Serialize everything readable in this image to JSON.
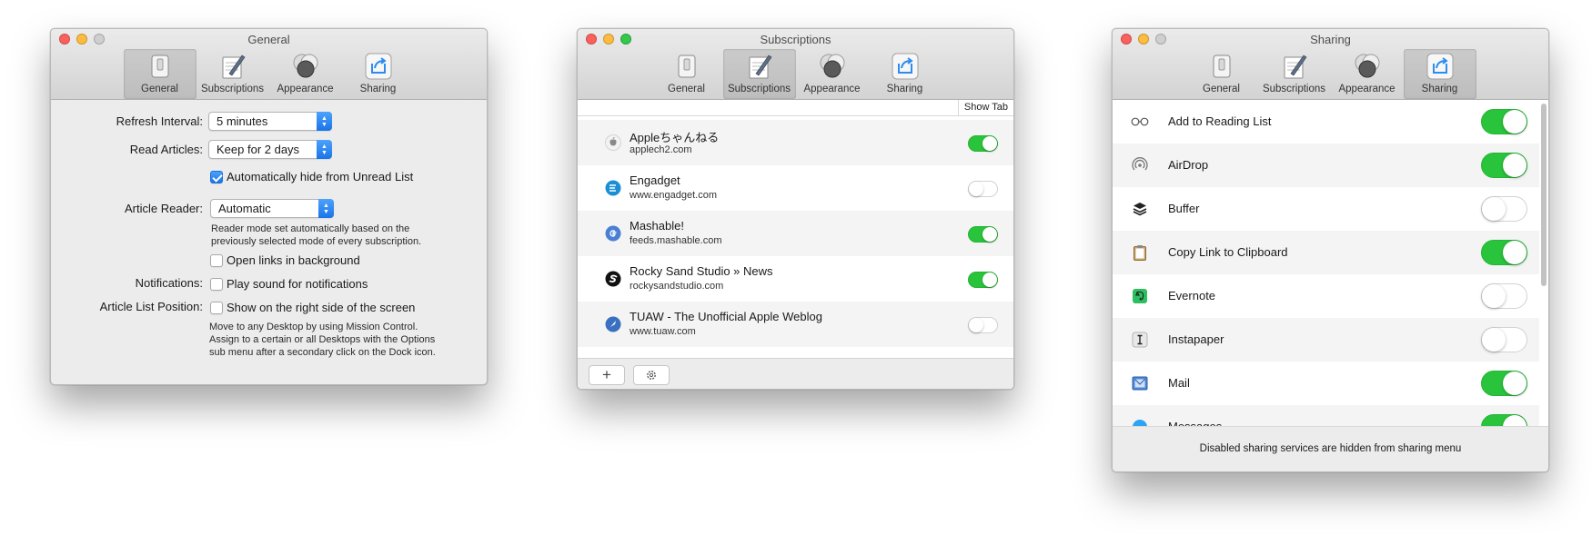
{
  "general_window": {
    "title": "General",
    "tabs": [
      "General",
      "Subscriptions",
      "Appearance",
      "Sharing"
    ],
    "active_tab": "General",
    "refresh_interval": {
      "label": "Refresh Interval:",
      "value": "5 minutes"
    },
    "read_articles": {
      "label": "Read Articles:",
      "value": "Keep for 2 days"
    },
    "auto_hide": {
      "label": "Automatically hide from Unread List",
      "checked": true
    },
    "article_reader": {
      "label": "Article Reader:",
      "value": "Automatic",
      "note_line1": "Reader mode set automatically based on the",
      "note_line2": "previously selected mode of every subscription."
    },
    "open_links": {
      "label": "Open links in background",
      "checked": false
    },
    "notifications": {
      "label": "Notifications:",
      "option": "Play sound for notifications",
      "checked": false
    },
    "article_list_position": {
      "label": "Article List Position:",
      "option": "Show on the right side of the screen",
      "checked": false,
      "note_line1": "Move to any Desktop by using Mission Control.",
      "note_line2": "Assign to a certain or all Desktops with the Options",
      "note_line3": "sub menu after a secondary click on the Dock icon."
    }
  },
  "subscriptions_window": {
    "title": "Subscriptions",
    "tabs": [
      "General",
      "Subscriptions",
      "Appearance",
      "Sharing"
    ],
    "active_tab": "Subscriptions",
    "show_tab_label": "Show Tab",
    "items": [
      {
        "title": "Appleちゃんねる",
        "url": "applech2.com",
        "enabled": true,
        "icon": "apple-icon",
        "color": "#d8d8d8"
      },
      {
        "title": "Engadget",
        "url": "www.engadget.com",
        "enabled": false,
        "icon": "engadget-icon",
        "color": "#1b8fd6"
      },
      {
        "title": "Mashable!",
        "url": "feeds.mashable.com",
        "enabled": true,
        "icon": "google-icon",
        "color": "#4a7fd4"
      },
      {
        "title": "Rocky Sand Studio » News",
        "url": "rockysandstudio.com",
        "enabled": true,
        "icon": "rocky-sand-icon",
        "color": "#111111"
      },
      {
        "title": "TUAW - The Unofficial Apple Weblog",
        "url": "www.tuaw.com",
        "enabled": false,
        "icon": "tuaw-icon",
        "color": "#3a6fc2"
      }
    ],
    "add_button": "+",
    "settings_button_icon": "gear-icon"
  },
  "sharing_window": {
    "title": "Sharing",
    "tabs": [
      "General",
      "Subscriptions",
      "Appearance",
      "Sharing"
    ],
    "active_tab": "Sharing",
    "services": [
      {
        "name": "Add to Reading List",
        "enabled": true,
        "icon": "glasses-icon"
      },
      {
        "name": "AirDrop",
        "enabled": true,
        "icon": "airdrop-icon"
      },
      {
        "name": "Buffer",
        "enabled": false,
        "icon": "buffer-icon"
      },
      {
        "name": "Copy Link to Clipboard",
        "enabled": true,
        "icon": "clipboard-icon"
      },
      {
        "name": "Evernote",
        "enabled": false,
        "icon": "evernote-icon"
      },
      {
        "name": "Instapaper",
        "enabled": false,
        "icon": "instapaper-icon"
      },
      {
        "name": "Mail",
        "enabled": true,
        "icon": "mail-icon"
      },
      {
        "name": "Messages",
        "enabled": true,
        "icon": "messages-icon"
      }
    ],
    "footer_note": "Disabled sharing services are hidden from sharing menu"
  },
  "colors": {
    "toggle_on": "#29c43b",
    "accent_blue": "#1a74e8",
    "window_bg": "#ececec"
  }
}
